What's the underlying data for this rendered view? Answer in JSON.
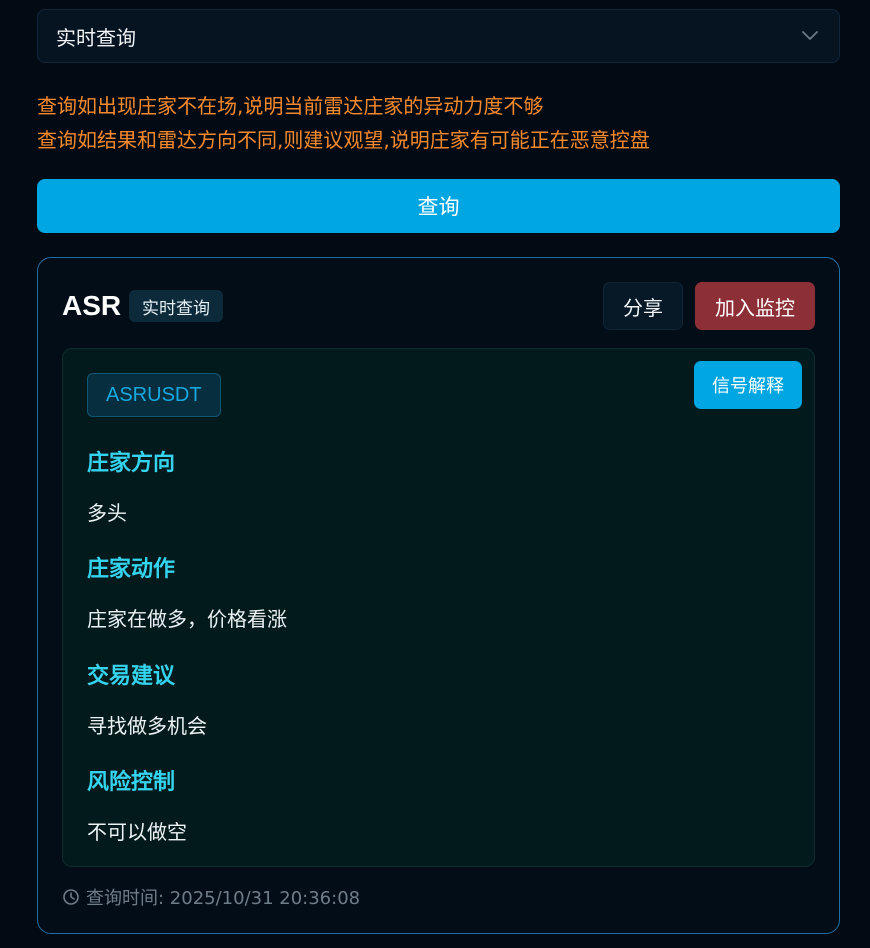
{
  "select": {
    "value": "实时查询"
  },
  "notice": {
    "line1": "查询如出现庄家不在场,说明当前雷达庄家的异动力度不够",
    "line2": "查询如结果和雷达方向不同,则建议观望,说明庄家有可能正在恶意控盘"
  },
  "query_button": "查询",
  "result": {
    "symbol": "ASR",
    "mode": "实时查询",
    "share": "分享",
    "add_monitor": "加入监控",
    "pair": "ASRUSDT",
    "explain": "信号解释",
    "sections": [
      {
        "title": "庄家方向",
        "value": "多头"
      },
      {
        "title": "庄家动作",
        "value": "庄家在做多，价格看涨"
      },
      {
        "title": "交易建议",
        "value": "寻找做多机会"
      },
      {
        "title": "风险控制",
        "value": "不可以做空"
      }
    ],
    "query_time": "查询时间: 2025/10/31 20:36:08"
  },
  "colors": {
    "accent": "#00a6e2",
    "danger": "#8d2f36",
    "warning_text": "#f5892c",
    "section_title": "#34d3ee"
  }
}
